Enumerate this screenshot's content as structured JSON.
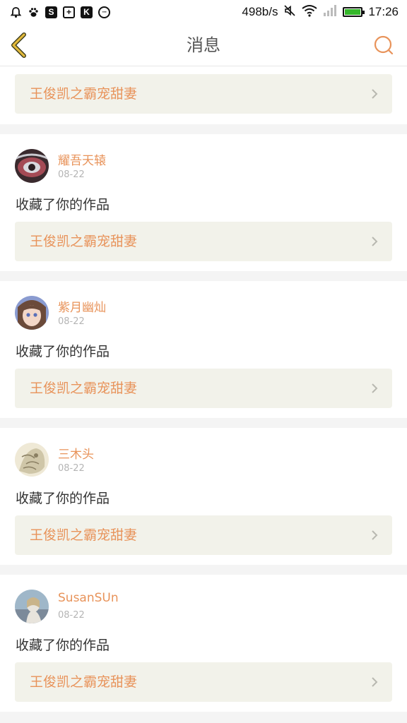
{
  "status_bar": {
    "speed": "498b/s",
    "time": "17:26",
    "battery_level": 1.0,
    "icons": [
      "alarm-icon",
      "baidu-paw-icon",
      "s-app-icon",
      "plus-app-icon",
      "k-app-icon",
      "more-dots-icon",
      "mute-icon",
      "wifi-icon",
      "signal-icon",
      "battery-icon"
    ]
  },
  "nav": {
    "title": "消息"
  },
  "top_partial": {
    "work_title": "王俊凯之霸宠甜妻"
  },
  "notifications": [
    {
      "username": "耀吾天辕",
      "date": "08-22",
      "action": "收藏了你的作品",
      "work_title": "王俊凯之霸宠甜妻",
      "avatar_colors": [
        "#3a2a2e",
        "#a44a55",
        "#d8d8de"
      ]
    },
    {
      "username": "紫月幽灿",
      "date": "08-22",
      "action": "收藏了你的作品",
      "work_title": "王俊凯之霸宠甜妻",
      "avatar_colors": [
        "#6b4a3a",
        "#f3d7c8",
        "#8a9bd0"
      ]
    },
    {
      "username": "三木头",
      "date": "08-22",
      "action": "收藏了你的作品",
      "work_title": "王俊凯之霸宠甜妻",
      "avatar_colors": [
        "#cfc6a8",
        "#8a7f62",
        "#efe9d6"
      ]
    },
    {
      "username": "SusanSUn",
      "date": "08-22",
      "action": "收藏了你的作品",
      "work_title": "王俊凯之霸宠甜妻",
      "avatar_colors": [
        "#9fb7c9",
        "#e8e4dc",
        "#7c8a9a"
      ]
    }
  ],
  "colors": {
    "accent": "#e8935a",
    "back_arrow": "#e2b93b",
    "link_bg": "#f2f2ea"
  }
}
